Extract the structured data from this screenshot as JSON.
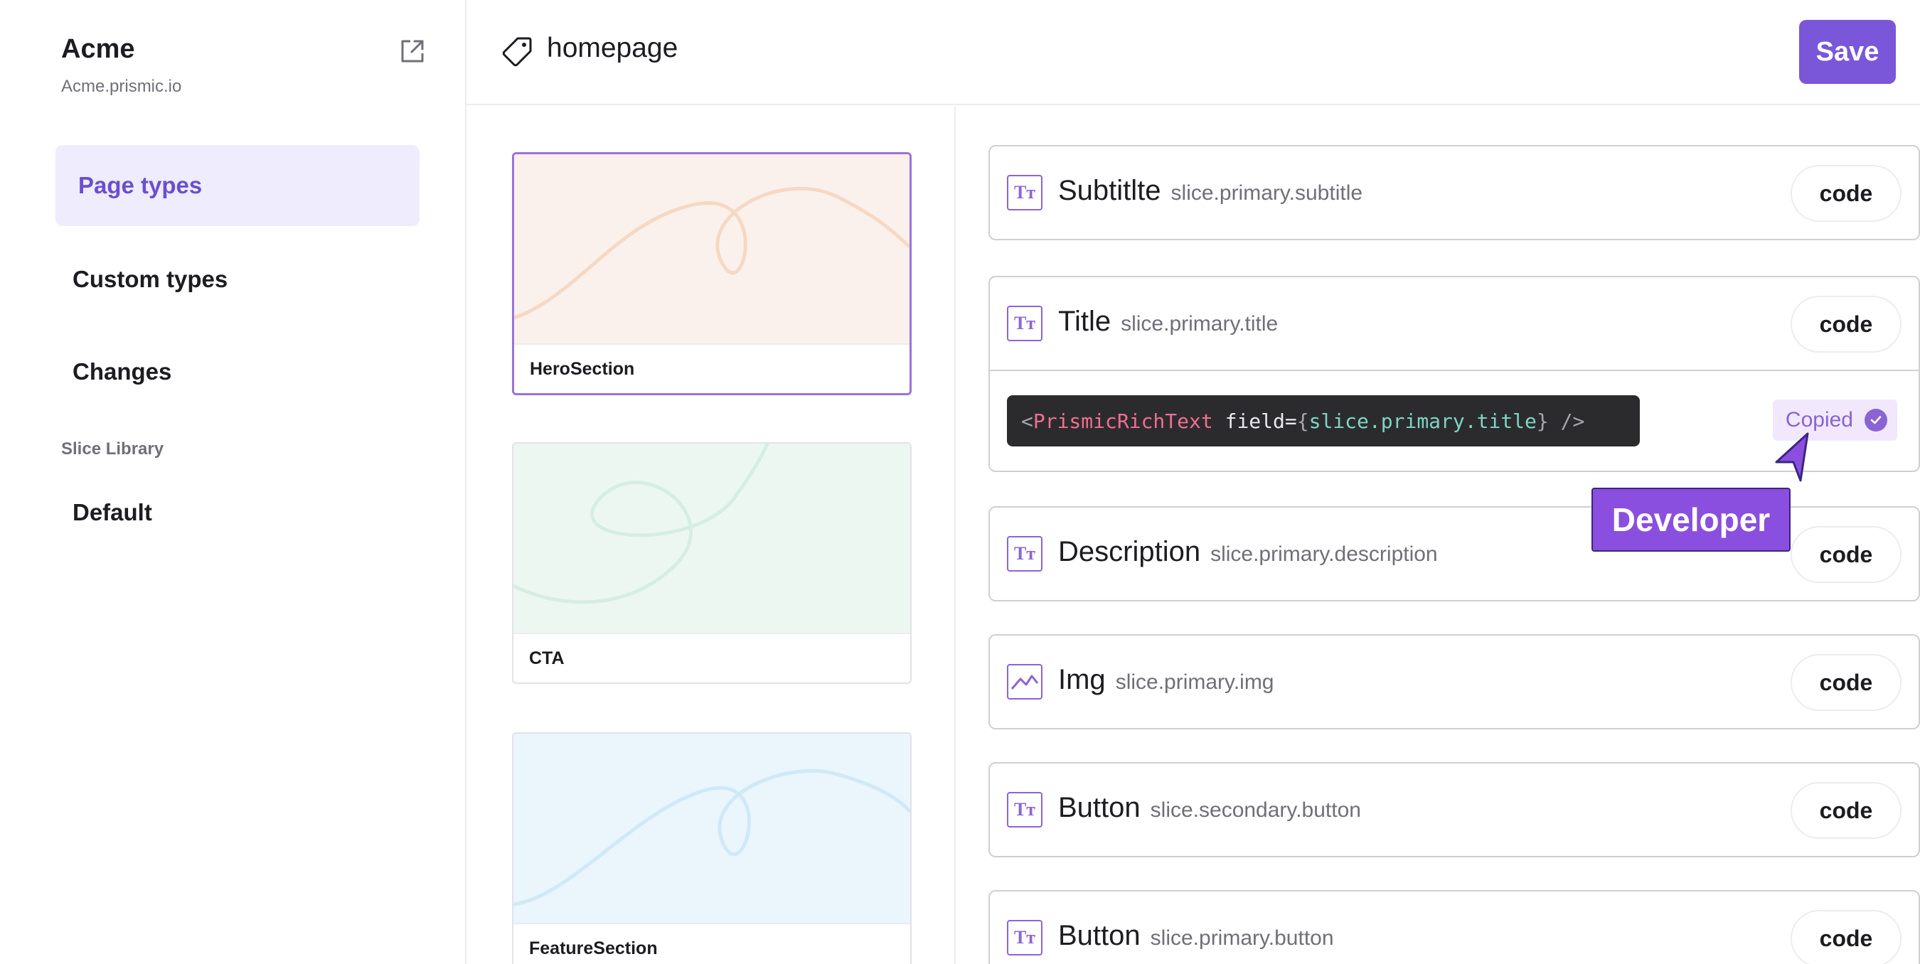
{
  "sidebar": {
    "brand_name": "Acme",
    "brand_domain": "Acme.prismic.io",
    "nav": [
      {
        "label": "Page types",
        "active": true
      },
      {
        "label": "Custom types",
        "active": false
      },
      {
        "label": "Changes",
        "active": false
      }
    ],
    "section_label": "Slice Library",
    "library_items": [
      {
        "label": "Default"
      }
    ]
  },
  "header": {
    "page_name": "homepage",
    "save_label": "Save"
  },
  "slices": [
    {
      "label": "HeroSection",
      "selected": true,
      "bg": "#fbf1ec",
      "line": "#f6d8c3"
    },
    {
      "label": "CTA",
      "selected": false,
      "bg": "#edf7f2",
      "line": "#d6eee2"
    },
    {
      "label": "FeatureSection",
      "selected": false,
      "bg": "#eaf5fc",
      "line": "#cfe9f7"
    }
  ],
  "fields": [
    {
      "name": "Subtitlte",
      "path": "slice.primary.subtitle",
      "icon": "text-icon",
      "button": "code"
    },
    {
      "name": "Title",
      "path": "slice.primary.title",
      "icon": "text-icon",
      "button": "code"
    },
    {
      "name": "Description",
      "path": "slice.primary.description",
      "icon": "text-icon",
      "button": "code"
    },
    {
      "name": "Img",
      "path": "slice.primary.img",
      "icon": "image-icon",
      "button": "code"
    },
    {
      "name": "Button",
      "path": "slice.secondary.button",
      "icon": "text-icon",
      "button": "code"
    },
    {
      "name": "Button",
      "path": "slice.primary.button",
      "icon": "text-icon",
      "button": "code"
    }
  ],
  "snippet": {
    "open": "<",
    "tag": "PrismicRichText",
    "attr": " field=",
    "brace_open": "{",
    "value": "slice.primary.title",
    "brace_close": "}",
    "close": " />"
  },
  "copied_label": "Copied",
  "cursor_tag": "Developer",
  "colors": {
    "accent": "#7a57d8",
    "active_nav_bg": "#efecfd",
    "cursor": "#8a4fde"
  }
}
